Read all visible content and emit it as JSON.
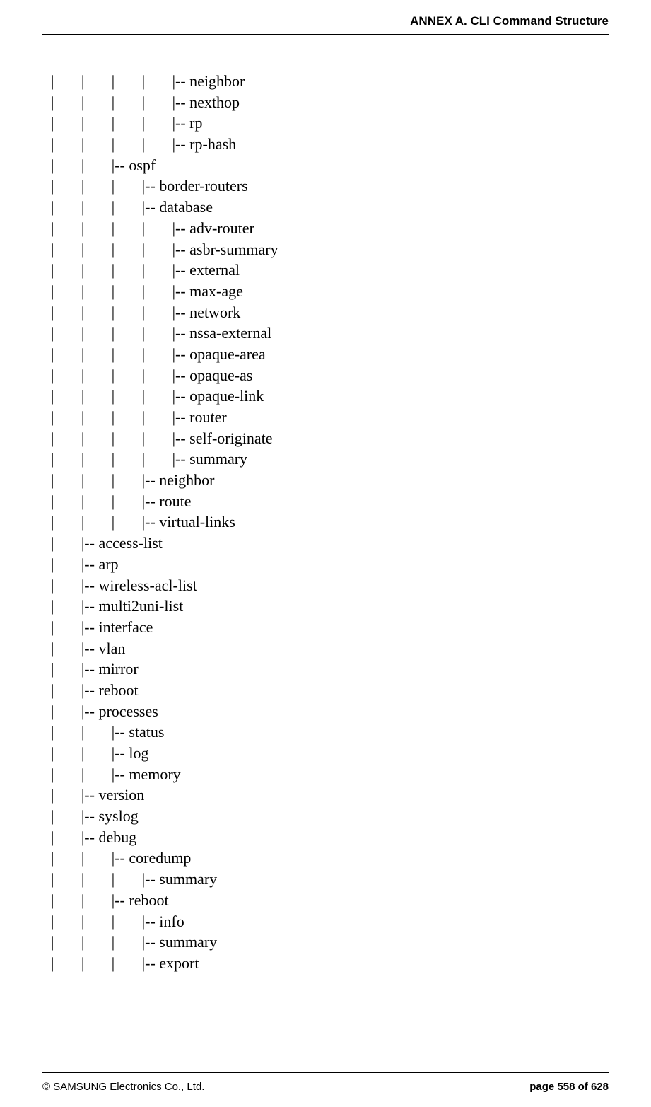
{
  "header": {
    "title": "ANNEX A. CLI Command Structure"
  },
  "lines": [
    "|       |       |       |       |-- neighbor",
    "|       |       |       |       |-- nexthop",
    "|       |       |       |       |-- rp",
    "|       |       |       |       |-- rp-hash",
    "|       |       |-- ospf",
    "|       |       |       |-- border-routers",
    "|       |       |       |-- database",
    "|       |       |       |       |-- adv-router",
    "|       |       |       |       |-- asbr-summary",
    "|       |       |       |       |-- external",
    "|       |       |       |       |-- max-age",
    "|       |       |       |       |-- network",
    "|       |       |       |       |-- nssa-external",
    "|       |       |       |       |-- opaque-area",
    "|       |       |       |       |-- opaque-as",
    "|       |       |       |       |-- opaque-link",
    "|       |       |       |       |-- router",
    "|       |       |       |       |-- self-originate",
    "|       |       |       |       |-- summary",
    "|       |       |       |-- neighbor",
    "|       |       |       |-- route",
    "|       |       |       |-- virtual-links",
    "|       |-- access-list",
    "|       |-- arp",
    "|       |-- wireless-acl-list",
    "|       |-- multi2uni-list",
    "|       |-- interface",
    "|       |-- vlan",
    "|       |-- mirror",
    "|       |-- reboot",
    "|       |-- processes",
    "|       |       |-- status",
    "|       |       |-- log",
    "|       |       |-- memory",
    "|       |-- version",
    "|       |-- syslog",
    "|       |-- debug",
    "|       |       |-- coredump",
    "|       |       |       |-- summary",
    "|       |       |-- reboot",
    "|       |       |       |-- info",
    "|       |       |       |-- summary",
    "|       |       |       |-- export"
  ],
  "footer": {
    "copyright": "© SAMSUNG Electronics Co., Ltd.",
    "page": "page 558 of 628"
  }
}
